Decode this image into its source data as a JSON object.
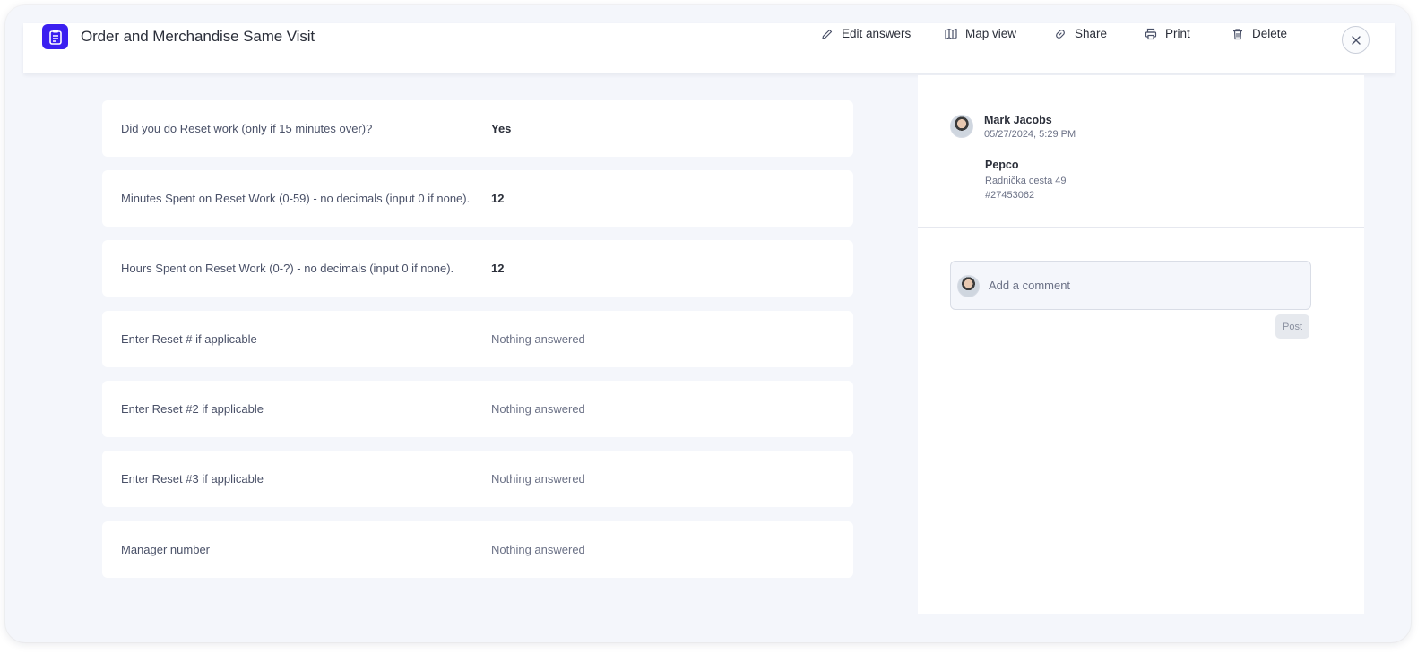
{
  "header": {
    "title": "Order and Merchandise Same Visit",
    "actions": {
      "edit": "Edit answers",
      "map": "Map view",
      "share": "Share",
      "print": "Print",
      "delete": "Delete"
    }
  },
  "answers": [
    {
      "question": "Did you do Reset work (only if 15 minutes over)?",
      "answer": "Yes"
    },
    {
      "question": "Minutes Spent on Reset Work (0-59) - no decimals (input 0 if none).",
      "answer": "12"
    },
    {
      "question": "Hours Spent on Reset Work (0-?) - no decimals (input 0 if none).",
      "answer": "12"
    },
    {
      "question": "Enter Reset # if applicable",
      "answer": "Nothing answered"
    },
    {
      "question": "Enter Reset #2 if applicable",
      "answer": "Nothing answered"
    },
    {
      "question": "Enter Reset #3 if applicable",
      "answer": "Nothing answered"
    },
    {
      "question": "Manager number",
      "answer": "Nothing answered"
    }
  ],
  "submission": {
    "user_name": "Mark Jacobs",
    "timestamp": "05/27/2024, 5:29 PM",
    "store_name": "Pepco",
    "store_address": "Radnička cesta 49",
    "store_id": "#27453062"
  },
  "comments": {
    "placeholder": "Add a comment",
    "post_label": "Post"
  },
  "colors": {
    "accent": "#3b1ff0",
    "background": "#f4f6fb"
  }
}
